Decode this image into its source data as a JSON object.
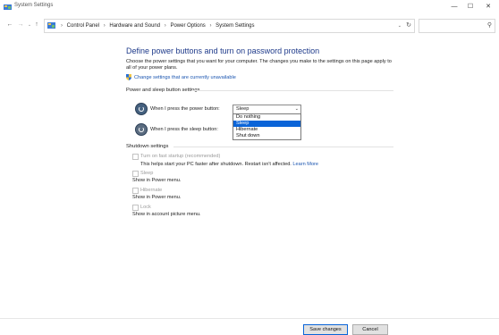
{
  "window": {
    "title": "System Settings",
    "controls": {
      "minimize": "—",
      "maximize": "☐",
      "close": "✕"
    }
  },
  "addressbar": {
    "back_icon": "←",
    "forward_icon": "→",
    "up_icon": "↑",
    "dropdown_icon": "⌄",
    "refresh_icon": "↻",
    "crumbs": [
      "Control Panel",
      "Hardware and Sound",
      "Power Options",
      "System Settings"
    ],
    "separator": "›",
    "search_placeholder": "",
    "search_icon": "⚲"
  },
  "page": {
    "title": "Define power buttons and turn on password protection",
    "intro": "Choose the power settings that you want for your computer. The changes you make to the settings on this page apply to all of your power plans.",
    "change_link": "Change settings that are currently unavailable"
  },
  "power_sleep": {
    "heading": "Power and sleep button settings",
    "power_button_label": "When I press the power button:",
    "power_button_value": "Sleep",
    "dropdown_options": [
      "Do nothing",
      "Sleep",
      "Hibernate",
      "Shut down"
    ],
    "dropdown_selected_index": 1,
    "sleep_button_label": "When I press the sleep button:"
  },
  "shutdown": {
    "heading": "Shutdown settings",
    "items": [
      {
        "label": "Turn on fast startup (recommended)",
        "desc": "This helps start your PC faster after shutdown. Restart isn't affected.",
        "link": "Learn More"
      },
      {
        "label": "Sleep",
        "desc": "Show in Power menu."
      },
      {
        "label": "Hibernate",
        "desc": "Show in Power menu."
      },
      {
        "label": "Lock",
        "desc": "Show in account picture menu."
      }
    ]
  },
  "footer": {
    "save_label": "Save changes",
    "cancel_label": "Cancel"
  },
  "colors": {
    "title": "#1e3a8a",
    "link": "#1a55b0",
    "selection": "#0a64d8"
  }
}
